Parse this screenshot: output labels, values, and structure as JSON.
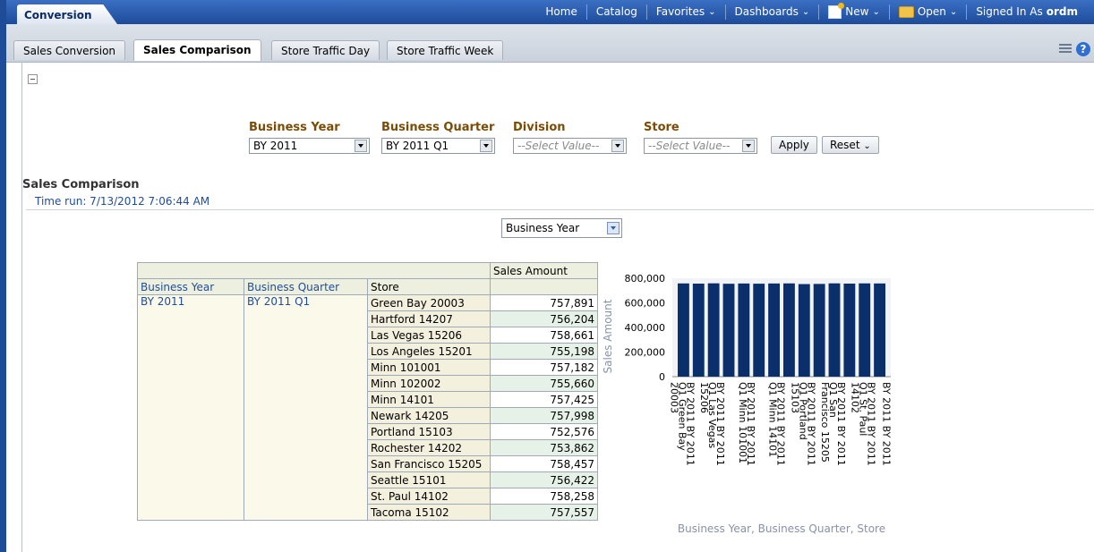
{
  "app_tab": "Conversion",
  "nav": {
    "home": "Home",
    "catalog": "Catalog",
    "favorites": "Favorites",
    "dashboards": "Dashboards",
    "new": "New",
    "open": "Open",
    "signed_in_prefix": "Signed In As",
    "user": "ordm"
  },
  "tabs": [
    "Sales Conversion",
    "Sales Comparison",
    "Store Traffic Day",
    "Store Traffic Week"
  ],
  "active_tab": "Sales Comparison",
  "prompts": {
    "business_year": {
      "label": "Business Year",
      "value": "BY 2011"
    },
    "business_quarter": {
      "label": "Business Quarter",
      "value": "BY 2011 Q1"
    },
    "division": {
      "label": "Division",
      "value": "--Select Value--"
    },
    "store": {
      "label": "Store",
      "value": "--Select Value--"
    },
    "apply": "Apply",
    "reset": "Reset"
  },
  "report": {
    "title": "Sales Comparison",
    "time_run": "Time run: 7/13/2012 7:06:44 AM",
    "view_selector": "Business Year"
  },
  "table": {
    "measure_header": "Sales Amount",
    "columns": [
      "Business Year",
      "Business Quarter",
      "Store"
    ],
    "business_year": "BY 2011",
    "business_quarter": "BY 2011 Q1",
    "rows": [
      {
        "store": "Green Bay 20003",
        "amount": "757,891"
      },
      {
        "store": "Hartford 14207",
        "amount": "756,204"
      },
      {
        "store": "Las Vegas 15206",
        "amount": "758,661"
      },
      {
        "store": "Los Angeles 15201",
        "amount": "755,198"
      },
      {
        "store": "Minn 101001",
        "amount": "757,182"
      },
      {
        "store": "Minn 102002",
        "amount": "755,660"
      },
      {
        "store": "Minn 14101",
        "amount": "757,425"
      },
      {
        "store": "Newark 14205",
        "amount": "757,998"
      },
      {
        "store": "Portland 15103",
        "amount": "752,576"
      },
      {
        "store": "Rochester 14202",
        "amount": "753,862"
      },
      {
        "store": "San Francisco 15205",
        "amount": "758,457"
      },
      {
        "store": "Seattle 15101",
        "amount": "756,422"
      },
      {
        "store": "St. Paul 14102",
        "amount": "758,258"
      },
      {
        "store": "Tacoma 15102",
        "amount": "757,557"
      }
    ]
  },
  "chart_data": {
    "type": "bar",
    "ylabel": "Sales Amount",
    "xlabel": "Business Year, Business Quarter, Store",
    "ylim": [
      0,
      800000
    ],
    "yticks": [
      "0",
      "200,000",
      "400,000",
      "600,000",
      "800,000"
    ],
    "categories": [
      "BY 2011 BY 2011 Q1 Green Bay 20003",
      "BY 2011 BY 2011 Q1 Hartford 14207",
      "BY 2011 BY 2011 Q1 Las Vegas 15206",
      "BY 2011 BY 2011 Q1 Los Angeles 15201",
      "BY 2011 BY 2011 Q1 Minn 101001",
      "BY 2011 BY 2011 Q1 Minn 102002",
      "BY 2011 BY 2011 Q1 Minn 14101",
      "BY 2011 BY 2011 Q1 Newark 14205",
      "BY 2011 BY 2011 Q1 Portland 15103",
      "BY 2011 BY 2011 Q1 Rochester 14202",
      "BY 2011 BY 2011 Q1 San Francisco 15205",
      "BY 2011 BY 2011 Q1 Seattle 15101",
      "BY 2011 BY 2011 Q1 St. Paul 14102",
      "BY 2011 BY 2011 Q1 Tacoma 15102"
    ],
    "xtick_labels": [
      [
        "BY 2011 BY 2011",
        "Q1 Green Bay",
        "20003"
      ],
      [],
      [
        "BY 2011 BY 2011",
        "Q1 Las Vegas",
        "15206"
      ],
      [],
      [
        "BY 2011 BY 2011",
        "Q1 Minn 101001"
      ],
      [],
      [
        "BY 2011 BY 2011",
        "Q1 Minn 14101"
      ],
      [],
      [
        "BY 2011 BY 2011",
        "Q1 Portland",
        "15103"
      ],
      [],
      [
        "BY 2011 BY 2011",
        "Q1 San",
        "Francisco 15205"
      ],
      [],
      [
        "BY 2011 BY 2011",
        "Q1 St. Paul",
        "14102"
      ],
      [
        "BY 2011 BY 2011"
      ]
    ],
    "values": [
      757891,
      756204,
      758661,
      755198,
      757182,
      755660,
      757425,
      757998,
      752576,
      753862,
      758457,
      756422,
      758258,
      757557
    ],
    "bar_color": "#0b2f6b"
  }
}
